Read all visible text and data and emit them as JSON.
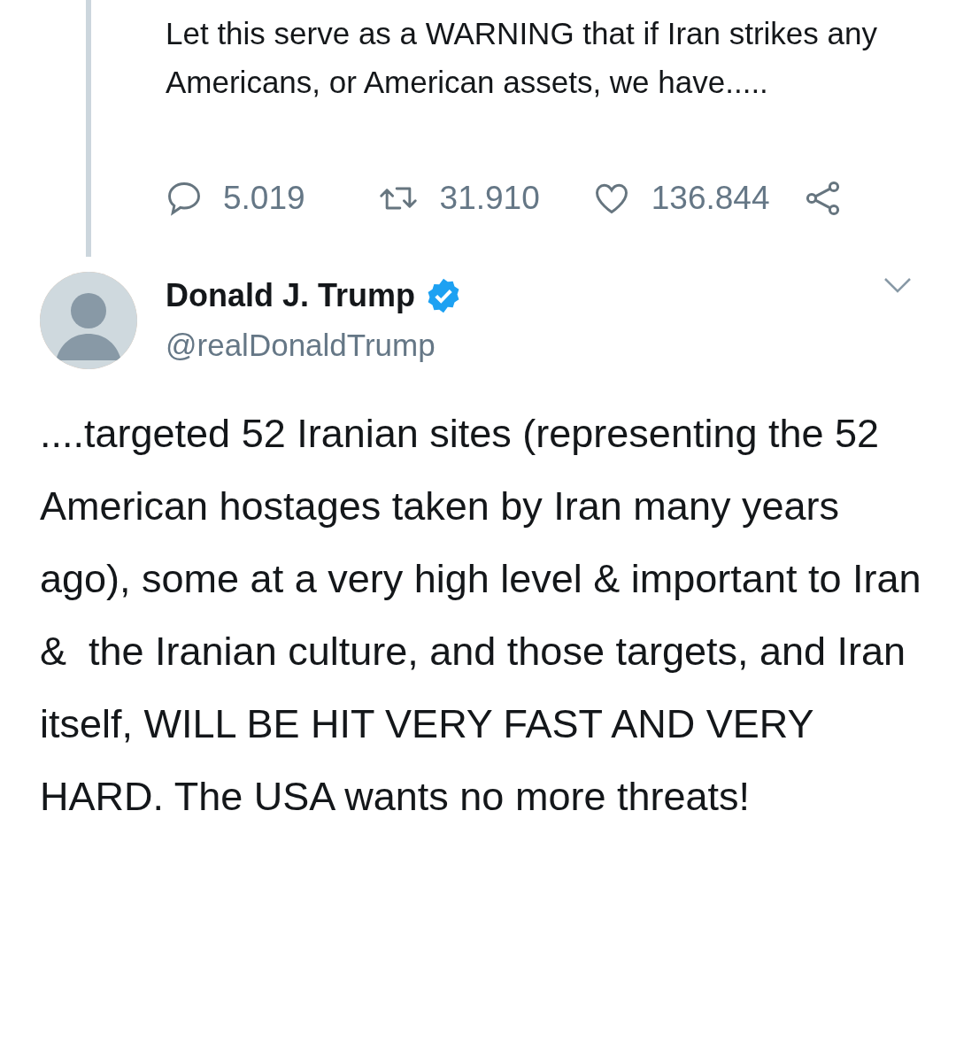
{
  "quoted_tweet": {
    "text": "Let this serve as a WARNING that if Iran strikes any Americans, or American assets, we have.....",
    "stats": [
      {
        "kind": "reply",
        "count": "5.019"
      },
      {
        "kind": "retweet",
        "count": "31.910"
      },
      {
        "kind": "like",
        "count": "136.844"
      },
      {
        "kind": "share"
      }
    ]
  },
  "tweet": {
    "author": {
      "name": "Donald J. Trump",
      "handle": "@realDonaldTrump",
      "verified": true
    },
    "text": "....targeted 52 Iranian sites (representing the 52 American hostages taken by Iran many years ago), some at a very high level & important to Iran &  the Iranian culture, and those targets, and Iran itself, WILL BE HIT VERY FAST AND VERY HARD. The USA wants no more threats!"
  }
}
